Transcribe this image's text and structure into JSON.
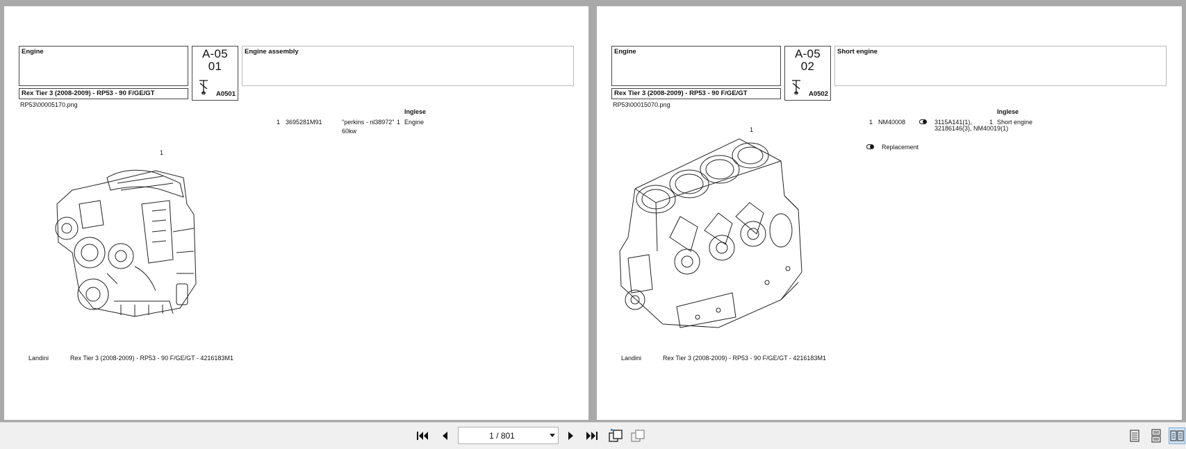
{
  "viewer": {
    "pages": [
      {
        "section": "Engine",
        "model": "Rex Tier 3 (2008-2009) - RP53 - 90 F/GE/GT",
        "code_line1": "A-05",
        "code_line2": "01",
        "code_small": "A0501",
        "description": "Engine assembly",
        "filename": "RP53\\00005170.png",
        "language_header": "Inglese",
        "callout": "1",
        "parts": [
          {
            "pos": "1",
            "part_no": "3695281M91",
            "note": "\"perkins - nl38972\"",
            "note2": "60kw",
            "qty": "1",
            "desc": "Engine"
          }
        ],
        "footer_brand": "Landini",
        "footer_model": "Rex Tier 3 (2008-2009) - RP53 - 90 F/GE/GT - 4216183M1"
      },
      {
        "section": "Engine",
        "model": "Rex Tier 3 (2008-2009) - RP53 - 90 F/GE/GT",
        "code_line1": "A-05",
        "code_line2": "02",
        "code_small": "A0502",
        "description": "Short engine",
        "filename": "RP53\\00015070.png",
        "language_header": "Inglese",
        "callout": "1",
        "parts": [
          {
            "pos": "1",
            "part_no": "NM40008",
            "note": "3115A141(1),",
            "note2": "32186146(3), NM40019(1)",
            "qty": "1",
            "desc": "Short engine"
          }
        ],
        "legend": "Replacement",
        "footer_brand": "Landini",
        "footer_model": "Rex Tier 3 (2008-2009) - RP53 - 90 F/GE/GT - 4216183M1"
      }
    ]
  },
  "toolbar": {
    "page_indicator": "1 / 801",
    "buttons": [
      "first-page-icon",
      "previous-page-icon",
      "next-page-icon",
      "last-page-icon",
      "rotate-back-icon",
      "rotate-forward-icon",
      "single-page-view-icon",
      "continuous-view-icon",
      "two-page-view-icon"
    ]
  }
}
